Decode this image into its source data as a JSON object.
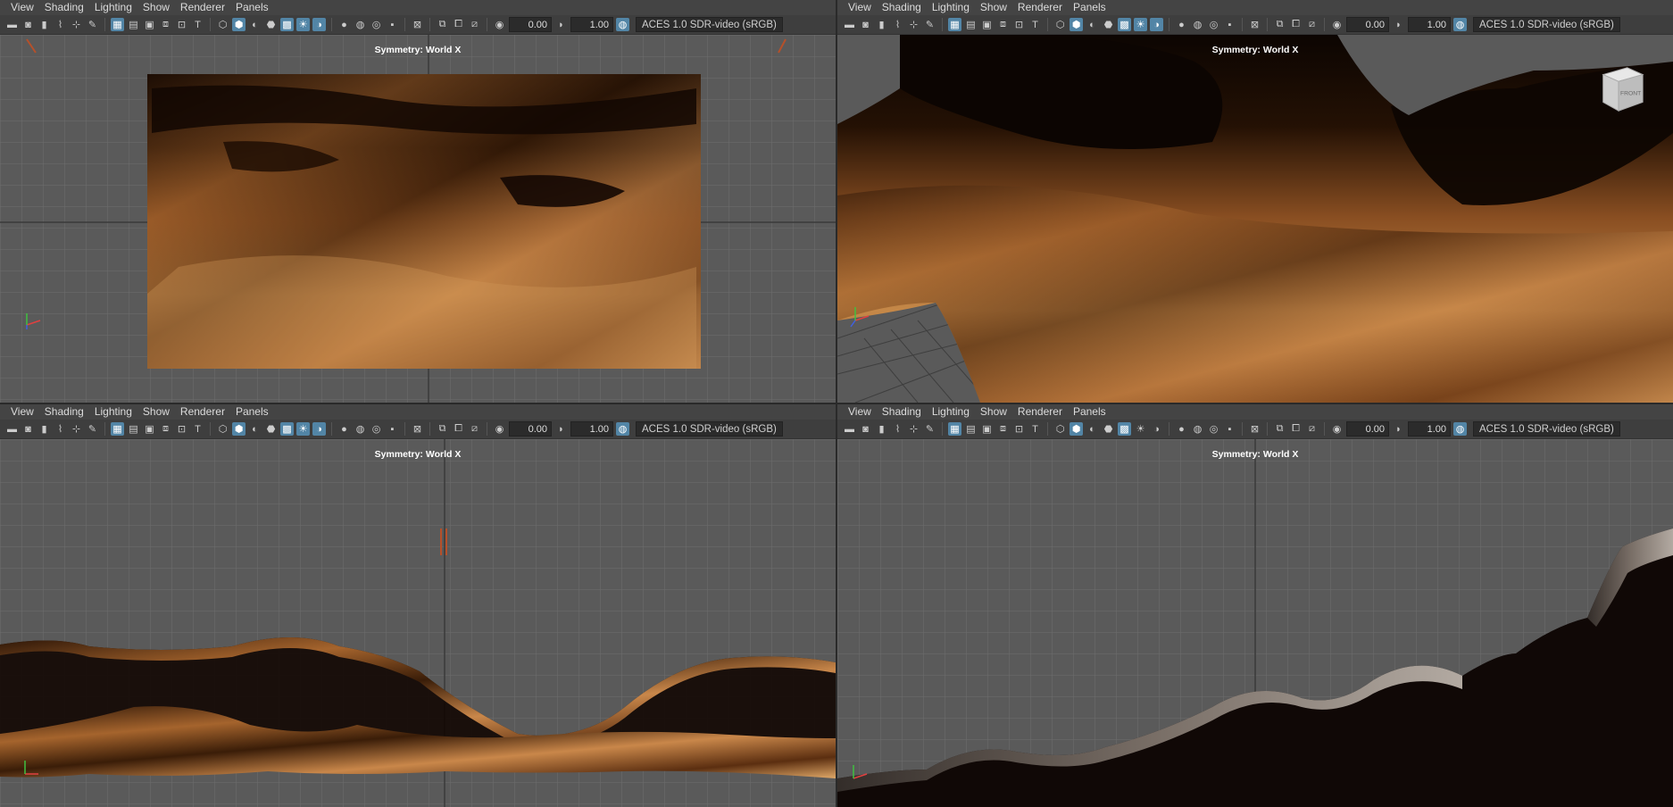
{
  "menus": [
    "View",
    "Shading",
    "Lighting",
    "Show",
    "Renderer",
    "Panels"
  ],
  "toolbar": {
    "exposure": "0.00",
    "gamma": "1.00",
    "color_space": "ACES 1.0 SDR-video (sRGB)"
  },
  "symmetry_label": "Symmetry: World X",
  "view_cube_label": "FRONT",
  "panels": [
    {
      "name": "top-left",
      "view": "top"
    },
    {
      "name": "top-right",
      "view": "perspective"
    },
    {
      "name": "bottom-left",
      "view": "front"
    },
    {
      "name": "bottom-right",
      "view": "side"
    }
  ],
  "colors": {
    "viewport_bg": "#5a5a5a",
    "grid_line": "#6c6c6c",
    "terrain_dark": "#1a0c03",
    "terrain_mid": "#8a4a1a",
    "terrain_light": "#e0a868",
    "accent": "#5285a6"
  }
}
